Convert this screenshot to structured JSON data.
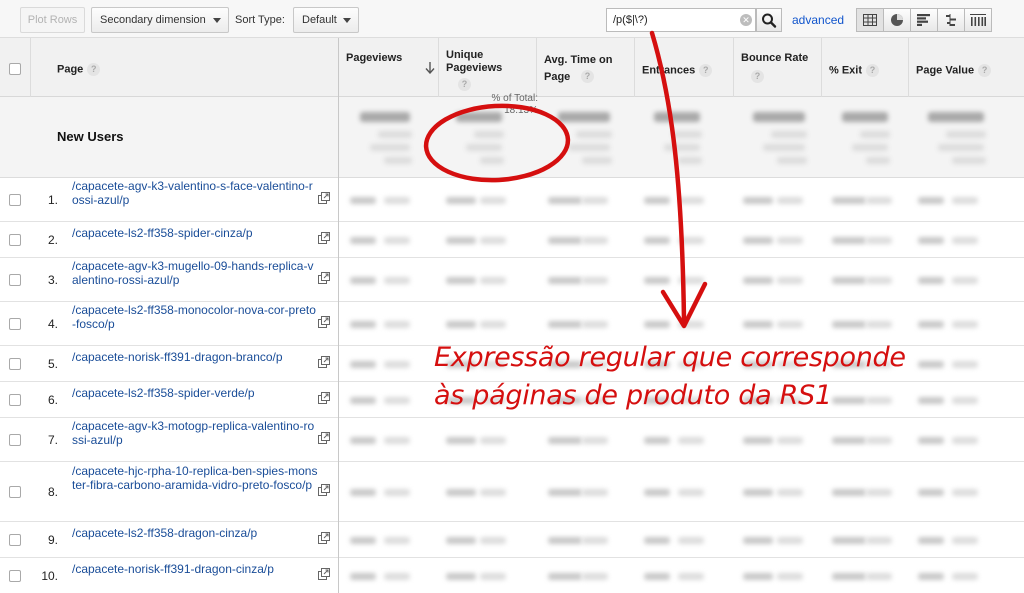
{
  "toolbar": {
    "plot_rows_label": "Plot Rows",
    "secondary_dimension_label": "Secondary dimension",
    "sort_type_label": "Sort Type:",
    "sort_type_value": "Default",
    "search_value": "/p($|\\?)",
    "advanced_label": "advanced",
    "view_icons": [
      "table-view-icon",
      "pie-view-icon",
      "bar-view-icon",
      "comparison-view-icon",
      "pivot-view-icon"
    ]
  },
  "columns": {
    "page": "Page",
    "pageviews": "Pageviews",
    "unique_pageviews": "Unique Pageviews",
    "avg_time": "Avg. Time on Page",
    "entrances": "Entrances",
    "bounce_rate": "Bounce Rate",
    "exit": "% Exit",
    "page_value": "Page Value"
  },
  "totals": {
    "segment_label": "New Users",
    "pct_label": "% of Total:",
    "pct_value": "18.13%"
  },
  "rows": [
    {
      "num": "1.",
      "page": "/capacete-agv-k3-valentino-s-face-valentino-rossi-azul/p"
    },
    {
      "num": "2.",
      "page": "/capacete-ls2-ff358-spider-cinza/p"
    },
    {
      "num": "3.",
      "page": "/capacete-agv-k3-mugello-09-hands-replica-valentino-rossi-azul/p"
    },
    {
      "num": "4.",
      "page": "/capacete-ls2-ff358-monocolor-nova-cor-preto-fosco/p"
    },
    {
      "num": "5.",
      "page": "/capacete-norisk-ff391-dragon-branco/p"
    },
    {
      "num": "6.",
      "page": "/capacete-ls2-ff358-spider-verde/p"
    },
    {
      "num": "7.",
      "page": "/capacete-agv-k3-motogp-replica-valentino-rossi-azul/p"
    },
    {
      "num": "8.",
      "page": "/capacete-hjc-rpha-10-replica-ben-spies-monster-fibra-carbono-aramida-vidro-preto-fosco/p"
    },
    {
      "num": "9.",
      "page": "/capacete-ls2-ff358-dragon-cinza/p"
    },
    {
      "num": "10.",
      "page": "/capacete-norisk-ff391-dragon-cinza/p"
    }
  ],
  "annotation": {
    "line1": "Expressão regular que corresponde",
    "line2": "às páginas de produto da RS1",
    "color": "#d50f0f"
  },
  "colors": {
    "link": "#1a4d98",
    "header_bg": "#f1f1f1",
    "accent_red": "#d50f0f"
  }
}
